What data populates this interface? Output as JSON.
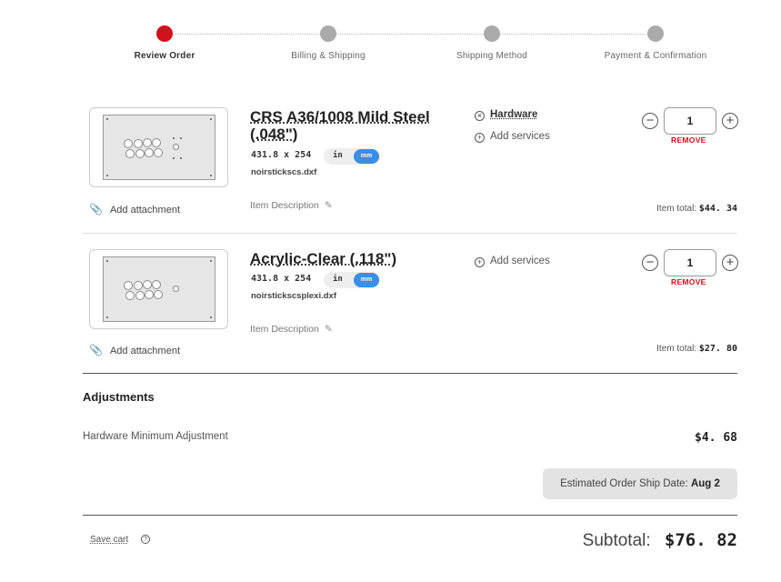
{
  "stepper": {
    "steps": [
      {
        "label": "Review Order"
      },
      {
        "label": "Billing & Shipping"
      },
      {
        "label": "Shipping Method"
      },
      {
        "label": "Payment & Confirmation"
      }
    ]
  },
  "items": [
    {
      "title": "CRS A36/1008 Mild Steel (.048\")",
      "dims": "431.8 x 254",
      "unit_in": "in",
      "unit_mm": "mm",
      "filename": "noirstickscs.dxf",
      "add_attachment": "Add attachment",
      "item_description": "Item Description",
      "hardware_label": "Hardware",
      "add_services": "Add services",
      "quantity": "1",
      "remove": "REMOVE",
      "item_total_label": "Item total:",
      "item_total_value": "$44. 34"
    },
    {
      "title": "Acrylic-Clear (.118\")",
      "dims": "431.8 x 254",
      "unit_in": "in",
      "unit_mm": "mm",
      "filename": "noirstickscsplexi.dxf",
      "add_attachment": "Add attachment",
      "item_description": "Item Description",
      "add_services": "Add services",
      "quantity": "1",
      "remove": "REMOVE",
      "item_total_label": "Item total:",
      "item_total_value": "$27. 80"
    }
  ],
  "adjustments": {
    "heading": "Adjustments",
    "label": "Hardware Minimum Adjustment",
    "value": "$4. 68"
  },
  "ship_date": {
    "label": "Estimated Order Ship Date:",
    "value": "Aug 2"
  },
  "footer": {
    "save_cart": "Save cart",
    "subtotal_label": "Subtotal:",
    "subtotal_value": "$76. 82"
  },
  "colors": {
    "accent_red": "#d0101b",
    "toggle_blue": "#3a8ee6"
  },
  "icons": {
    "attachment": "paperclip-icon",
    "edit": "pencil-icon",
    "hardware": "x-circle-icon",
    "services": "plus-circle-icon",
    "help": "question-circle-icon"
  }
}
